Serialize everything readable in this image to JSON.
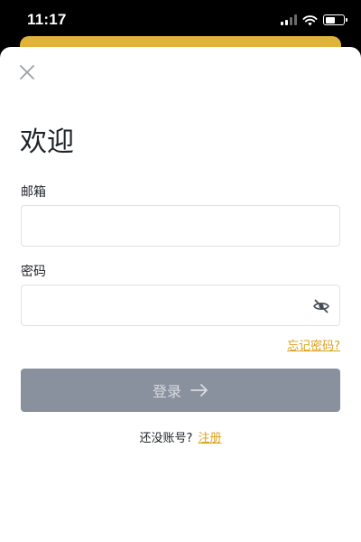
{
  "status_bar": {
    "time": "11:17",
    "icons": [
      "signal-icon",
      "wifi-icon",
      "battery-icon"
    ]
  },
  "login": {
    "close_icon": "close-icon",
    "title": "欢迎",
    "email_label": "邮箱",
    "email_value": "",
    "email_placeholder": "",
    "password_label": "密码",
    "password_value": "",
    "password_placeholder": "",
    "password_toggle_icon": "eye-off-icon",
    "forgot_label": "忘记密码?",
    "submit_label": "登录",
    "submit_icon": "arrow-right-icon",
    "register_prompt": "还没账号?",
    "register_label": "注册"
  },
  "colors": {
    "accent": "#d9a21b",
    "banner": "#e0b43a",
    "button_disabled": "#8a919e",
    "text": "#1e2329",
    "border": "#dfe1e5"
  }
}
